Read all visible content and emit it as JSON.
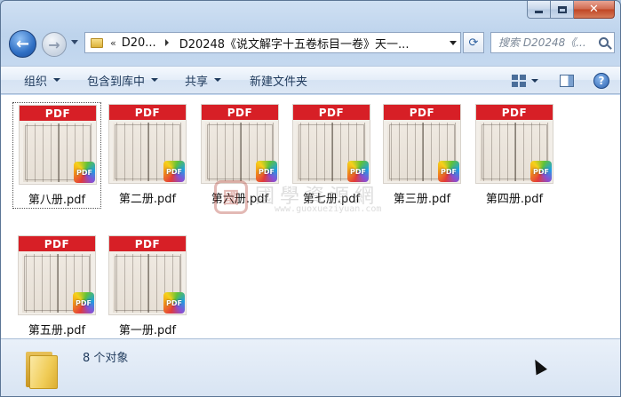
{
  "window": {
    "caption_buttons": {
      "minimize_icon": "minimize-icon",
      "maximize_icon": "maximize-icon",
      "close_icon": "close-icon",
      "close_glyph": "✕"
    }
  },
  "nav": {
    "back_glyph": "←",
    "forward_glyph": "→",
    "address": {
      "prefix": "«",
      "crumb1": "D20...",
      "crumb2": "D20248《说文解字十五卷标目一卷》天一..."
    },
    "refresh_glyph": "⟳",
    "search": {
      "placeholder": "搜索 D20248《..."
    }
  },
  "toolbar": {
    "organize": "组织",
    "include_in_library": "包含到库中",
    "share": "共享",
    "new_folder": "新建文件夹",
    "help_glyph": "?"
  },
  "files": [
    {
      "name": "第八册.pdf",
      "thumb_label": "PDF",
      "badge": "PDF",
      "selected": true
    },
    {
      "name": "第二册.pdf",
      "thumb_label": "PDF",
      "badge": "PDF",
      "selected": false
    },
    {
      "name": "第六册.pdf",
      "thumb_label": "PDF",
      "badge": "PDF",
      "selected": false
    },
    {
      "name": "第七册.pdf",
      "thumb_label": "PDF",
      "badge": "PDF",
      "selected": false
    },
    {
      "name": "第三册.pdf",
      "thumb_label": "PDF",
      "badge": "PDF",
      "selected": false
    },
    {
      "name": "第四册.pdf",
      "thumb_label": "PDF",
      "badge": "PDF",
      "selected": false
    },
    {
      "name": "第五册.pdf",
      "thumb_label": "PDF",
      "badge": "PDF",
      "selected": false
    },
    {
      "name": "第一册.pdf",
      "thumb_label": "PDF",
      "badge": "PDF",
      "selected": false
    }
  ],
  "watermark": {
    "seal": "國",
    "text": "國學資源網",
    "url": "www.guoxueziyuan.com"
  },
  "details": {
    "item_count": "8 个对象"
  },
  "colors": {
    "pdf_band": "#d71f26",
    "toolbar_text": "#1e395b"
  }
}
